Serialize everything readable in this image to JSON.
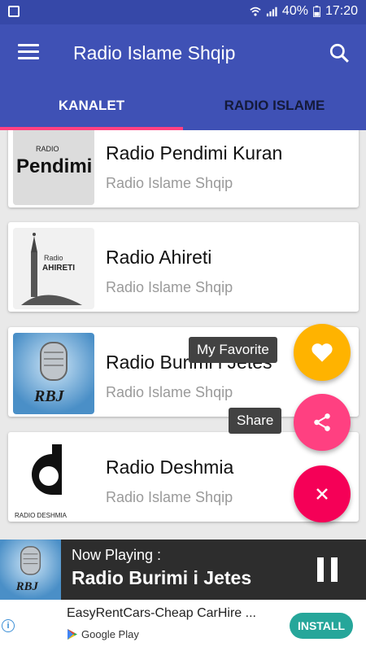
{
  "status_bar": {
    "battery": "40%",
    "time": "17:20"
  },
  "app_bar": {
    "title": "Radio Islame Shqip"
  },
  "tabs": [
    {
      "label": "KANALET",
      "active": true
    },
    {
      "label": "RADIO ISLAME",
      "active": false
    }
  ],
  "stations": [
    {
      "title": "Radio Pendimi Kuran",
      "subtitle": "Radio Islame Shqip",
      "logo_text": "Pendimi",
      "logo_small": "RADIO"
    },
    {
      "title": "Radio Ahireti",
      "subtitle": "Radio Islame Shqip",
      "logo_text": "AHIRETI",
      "logo_small": "Radio"
    },
    {
      "title": "Radio Burimi i Jetes",
      "subtitle": "Radio Islame Shqip",
      "logo_text": "RBJ"
    },
    {
      "title": "Radio Deshmia",
      "subtitle": "Radio Islame Shqip",
      "logo_text": "RADIO DESHMIA"
    }
  ],
  "fab_menu": {
    "favorite_label": "My Favorite",
    "share_label": "Share"
  },
  "player": {
    "now_playing_label": "Now Playing :",
    "station": "Radio Burimi i Jetes",
    "logo_text": "RBJ"
  },
  "ad": {
    "title": "EasyRentCars-Cheap CarHire ...",
    "store": "Google Play",
    "cta": "INSTALL",
    "info": "i"
  },
  "colors": {
    "status_bar": "#3648a8",
    "primary": "#3f51b5",
    "accent": "#ff4081",
    "favorite": "#ffb300",
    "close": "#f50057",
    "install": "#26a69a"
  }
}
